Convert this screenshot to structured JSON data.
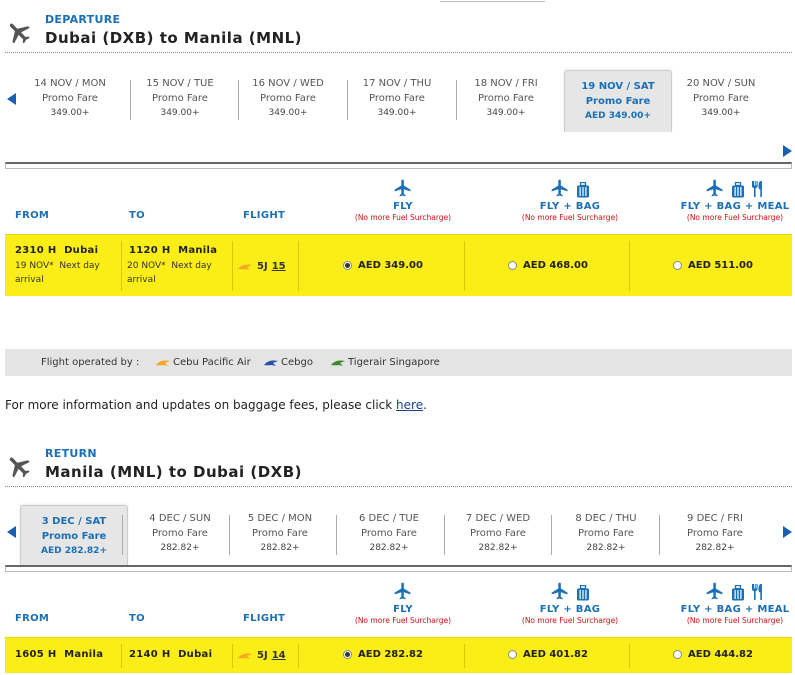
{
  "departure": {
    "kicker": "DEPARTURE",
    "title": "Dubai (DXB) to Manila (MNL)",
    "dates": [
      {
        "date": "14 NOV / MON",
        "fare": "Promo Fare",
        "price": "349.00+"
      },
      {
        "date": "15 NOV / TUE",
        "fare": "Promo Fare",
        "price": "349.00+"
      },
      {
        "date": "16 NOV / WED",
        "fare": "Promo Fare",
        "price": "349.00+"
      },
      {
        "date": "17 NOV / THU",
        "fare": "Promo Fare",
        "price": "349.00+"
      },
      {
        "date": "18 NOV / FRI",
        "fare": "Promo Fare",
        "price": "349.00+"
      },
      {
        "date": "19 NOV / SAT",
        "fare": "Promo Fare",
        "price": "AED 349.00+"
      },
      {
        "date": "20 NOV / SUN",
        "fare": "Promo Fare",
        "price": "349.00+"
      }
    ],
    "selected_date_index": 5,
    "columns": {
      "from": "FROM",
      "to": "TO",
      "flight": "FLIGHT"
    },
    "options": [
      {
        "label": "FLY",
        "note": "(No more Fuel Surcharge)",
        "icons": [
          "plane-icon"
        ]
      },
      {
        "label": "FLY + BAG",
        "note": "(No more Fuel Surcharge)",
        "icons": [
          "plane-icon",
          "baggage-icon"
        ]
      },
      {
        "label": "FLY + BAG + MEAL",
        "note": "(No more Fuel Surcharge)",
        "icons": [
          "plane-icon",
          "baggage-icon",
          "meal-icon"
        ]
      }
    ],
    "flight": {
      "from_time": "2310 H",
      "from_city": "Dubai",
      "from_date": "19 NOV*",
      "from_note": "Next day",
      "from_note2": "arrival",
      "to_time": "1120 H",
      "to_city": "Manila",
      "to_date": "20 NOV*",
      "to_note": "Next day",
      "to_note2": "arrival",
      "carrier": "5J",
      "number": "15",
      "prices": [
        "AED 349.00",
        "AED 468.00",
        "AED 511.00"
      ],
      "selected_price_index": 0
    }
  },
  "operators": {
    "label": "Flight operated by :",
    "items": [
      {
        "name": "Cebu Pacific Air",
        "color": "#f5a623"
      },
      {
        "name": "Cebgo",
        "color": "#2b4fa8"
      },
      {
        "name": "Tigerair Singapore",
        "color": "#3a8a2a"
      }
    ]
  },
  "info": {
    "text": "For more information and updates on baggage fees, please click ",
    "link": "here",
    "tail": "."
  },
  "return": {
    "kicker": "RETURN",
    "title": "Manila (MNL) to Dubai (DXB)",
    "dates": [
      {
        "date": "3 DEC / SAT",
        "fare": "Promo Fare",
        "price": "AED 282.82+"
      },
      {
        "date": "4 DEC / SUN",
        "fare": "Promo Fare",
        "price": "282.82+"
      },
      {
        "date": "5 DEC / MON",
        "fare": "Promo Fare",
        "price": "282.82+"
      },
      {
        "date": "6 DEC / TUE",
        "fare": "Promo Fare",
        "price": "282.82+"
      },
      {
        "date": "7 DEC / WED",
        "fare": "Promo Fare",
        "price": "282.82+"
      },
      {
        "date": "8 DEC / THU",
        "fare": "Promo Fare",
        "price": "282.82+"
      },
      {
        "date": "9 DEC / FRI",
        "fare": "Promo Fare",
        "price": "282.82+"
      }
    ],
    "selected_date_index": 0,
    "columns": {
      "from": "FROM",
      "to": "TO",
      "flight": "FLIGHT"
    },
    "options": [
      {
        "label": "FLY",
        "note": "(No more Fuel Surcharge)",
        "icons": [
          "plane-icon"
        ]
      },
      {
        "label": "FLY + BAG",
        "note": "(No more Fuel Surcharge)",
        "icons": [
          "plane-icon",
          "baggage-icon"
        ]
      },
      {
        "label": "FLY + BAG + MEAL",
        "note": "(No more Fuel Surcharge)",
        "icons": [
          "plane-icon",
          "baggage-icon",
          "meal-icon"
        ]
      }
    ],
    "flight": {
      "from_time": "1605 H",
      "from_city": "Manila",
      "to_time": "2140 H",
      "to_city": "Dubai",
      "carrier": "5J",
      "number": "14",
      "prices": [
        "AED 282.82",
        "AED 401.82",
        "AED 444.82"
      ],
      "selected_price_index": 0
    }
  },
  "colors": {
    "accent": "#1a6fb5",
    "highlight_row": "#fbee16",
    "surcharge_note": "#cc1111",
    "arrow": "#1a5fb0"
  }
}
